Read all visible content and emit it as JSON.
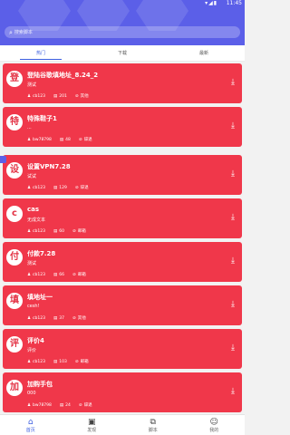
{
  "status": {
    "time": "11:45",
    "icons": "▾◢▮"
  },
  "search": {
    "placeholder": "搜索脚本"
  },
  "tabs": [
    {
      "label": "热门"
    },
    {
      "label": "下载"
    },
    {
      "label": "最新"
    }
  ],
  "cards": [
    {
      "avatar": "登",
      "title": "登陆谷歌填地址_8.24_2",
      "subtitle": "测试",
      "author": "cb123",
      "count": "201",
      "tag": "其他"
    },
    {
      "avatar": "特",
      "title": "特殊鞋子1",
      "subtitle": "...",
      "author": "bw78798",
      "count": "48",
      "tag": "辞退"
    },
    {
      "avatar": "设",
      "title": "设置VPN7.28",
      "subtitle": "试试",
      "author": "cb123",
      "count": "129",
      "tag": "辞退"
    },
    {
      "avatar": "c",
      "title": "cas",
      "subtitle": "无成文本",
      "author": "cb123",
      "count": "60",
      "tag": "邮箱"
    },
    {
      "avatar": "付",
      "title": "付款7.28",
      "subtitle": "测试",
      "author": "cb123",
      "count": "66",
      "tag": "邮箱"
    },
    {
      "avatar": "填",
      "title": "填地址一",
      "subtitle": "cesh!",
      "author": "cb123",
      "count": "37",
      "tag": "其他"
    },
    {
      "avatar": "评",
      "title": "评价4",
      "subtitle": "评价",
      "author": "cb123",
      "count": "103",
      "tag": "邮箱"
    },
    {
      "avatar": "加",
      "title": "加购手包",
      "subtitle": "000",
      "author": "bw78798",
      "count": "24",
      "tag": "辞退"
    }
  ],
  "nav": [
    {
      "label": "首页",
      "icon": "home-icon"
    },
    {
      "label": "发现",
      "icon": "discover-icon"
    },
    {
      "label": "脚本",
      "icon": "code-icon"
    },
    {
      "label": "我的",
      "icon": "user-icon"
    }
  ]
}
